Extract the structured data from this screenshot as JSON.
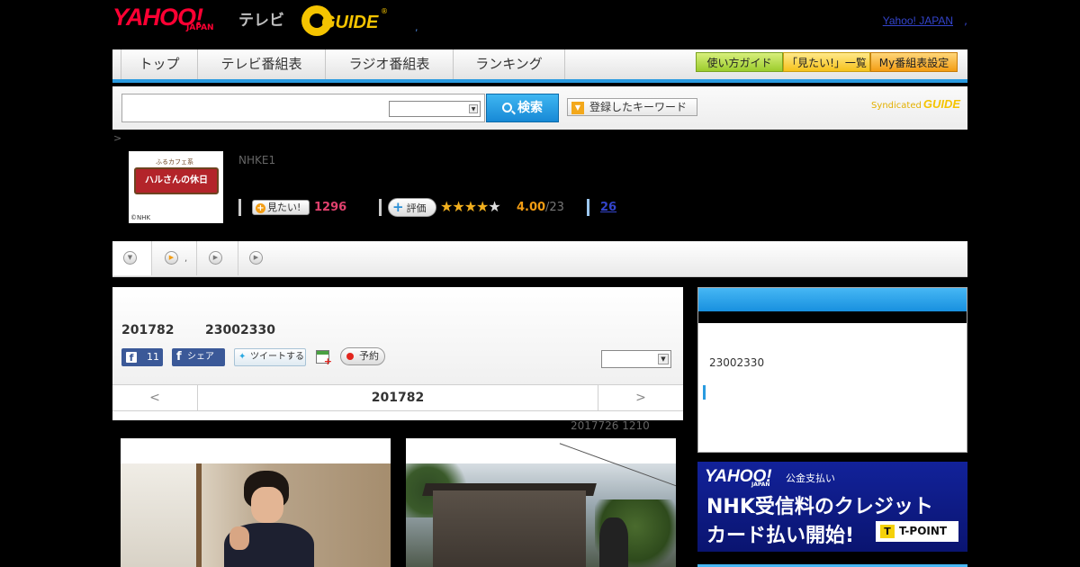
{
  "header": {
    "logo_yahoo": "YAHOO!",
    "logo_japan": "JAPAN",
    "logo_tv": "テレビ",
    "logo_gguide": "GUIDE",
    "logo_gguide_mark": "®",
    "separator": ",",
    "yahoo_japan_link": "Yahoo! JAPAN",
    "yahoo_japan_link_tail": ","
  },
  "nav": {
    "tabs": [
      {
        "label": "トップ"
      },
      {
        "label": "テレビ番組表"
      },
      {
        "label": "ラジオ番組表"
      },
      {
        "label": "ランキング"
      }
    ],
    "buttons": [
      {
        "label": "使い方ガイド"
      },
      {
        "label": "「見たい!」一覧"
      },
      {
        "label": "My番組表設定"
      }
    ],
    "accent_color": "#2a9be0"
  },
  "search": {
    "value": "",
    "select_value": "",
    "button_label": "検索",
    "keyword_button_label": "登録したキーワード",
    "syndicated_label": "Syndicated",
    "syndicated_logo": "GUIDE"
  },
  "breadcrumb": ">",
  "program": {
    "thumb_top_text": "ふるカフェ系",
    "thumb_title": "ハルさんの休日",
    "thumb_copyright": "©NHK",
    "channel": "NHKE1",
    "mitai_label": "見たい!",
    "mitai_count": "1296",
    "hyoka_label": "評価",
    "rating": "4.00",
    "rating_count": "/23",
    "stars_filled": "★★★★",
    "stars_empty": "★",
    "review_count": "26"
  },
  "subtabs": {
    "dot": ","
  },
  "episode": {
    "date": "201782",
    "time": "23002330",
    "facebook_like_count": "11",
    "facebook_share_label": "シェア",
    "tweet_label": "ツイートする",
    "record_label": "予約",
    "select_value": "",
    "pager_prev": "<",
    "pager_label": "201782",
    "pager_next": ">",
    "updated": "2017726  1210"
  },
  "sidebar": {
    "time": "23002330"
  },
  "ad": {
    "yahoo": "YAHOO!",
    "japan": "JAPAN",
    "kokin": "公金支払い",
    "line1": "NHK受信料のクレジット",
    "line2": "カード払い開始!",
    "tpoint": "T-POINT"
  }
}
